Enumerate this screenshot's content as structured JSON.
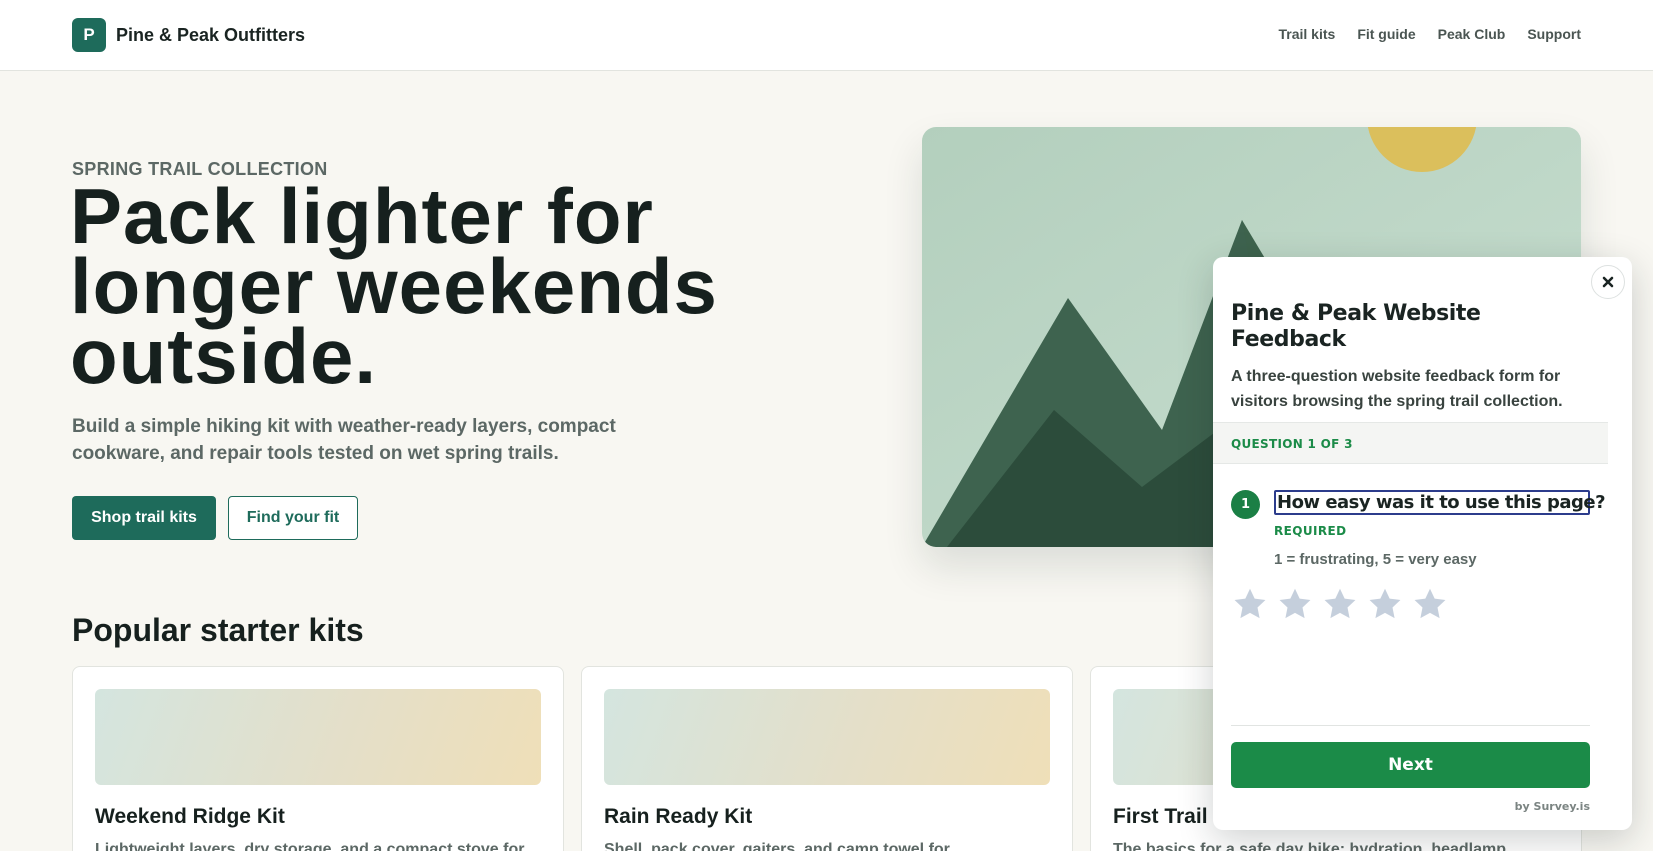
{
  "header": {
    "logo_letter": "P",
    "brand_name": "Pine & Peak Outfitters",
    "nav": [
      "Trail kits",
      "Fit guide",
      "Peak Club",
      "Support"
    ]
  },
  "hero": {
    "eyebrow": "SPRING TRAIL COLLECTION",
    "title": "Pack lighter for longer weekends outside.",
    "subtitle": "Build a simple hiking kit with weather-ready layers, compact cookware, and repair tools tested on wet spring trails.",
    "primary_cta": "Shop trail kits",
    "secondary_cta": "Find your fit"
  },
  "kits": {
    "heading": "Popular starter kits",
    "items": [
      {
        "title": "Weekend Ridge Kit",
        "description": "Lightweight layers, dry storage, and a compact stove for"
      },
      {
        "title": "Rain Ready Kit",
        "description": "Shell, pack cover, gaiters, and camp towel for"
      },
      {
        "title": "First Trail Kit",
        "description": "The basics for a safe day hike: hydration, headlamp,"
      }
    ]
  },
  "survey": {
    "title": "Pine & Peak Website Feedback",
    "description": "A three-question website feedback form for visitors browsing the spring trail collection.",
    "progress": "QUESTION 1 OF 3",
    "question_number": "1",
    "question_text": "How easy was it to use this page?",
    "required_label": "REQUIRED",
    "hint": "1 = frustrating, 5 = very easy",
    "rating_max": 5,
    "rating_value": 0,
    "next_label": "Next",
    "powered_by": "by Survey.is"
  },
  "colors": {
    "brand": "#1e6b5b",
    "survey_accent": "#1b8b48",
    "star_empty": "#c5cfdc",
    "background": "#f8f7f2"
  },
  "icons": [
    "close-icon",
    "star-icon"
  ]
}
